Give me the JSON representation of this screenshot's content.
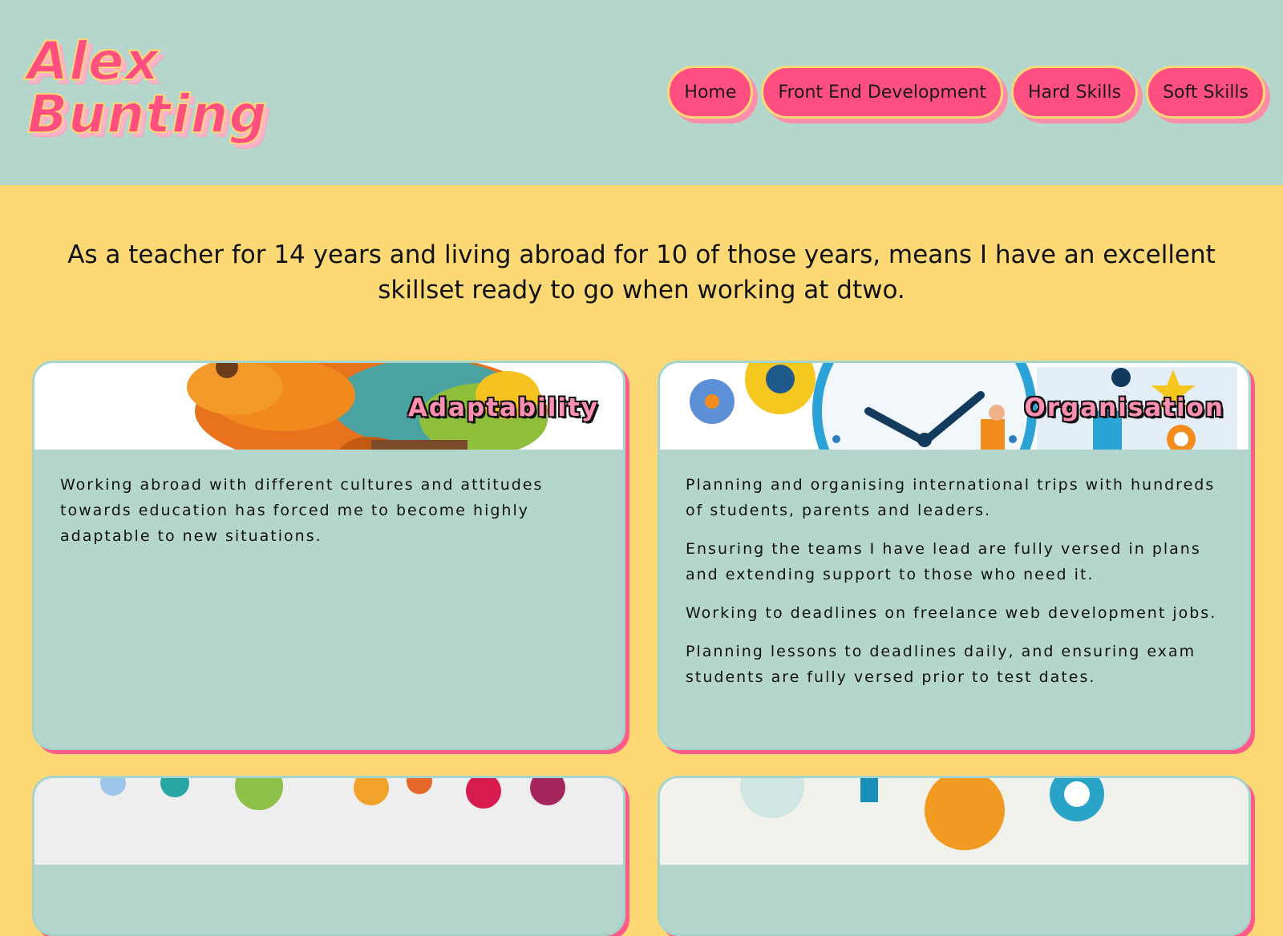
{
  "site": {
    "logo_line1": "Alex",
    "logo_line2": "Bunting"
  },
  "nav": {
    "items": [
      {
        "label": "Home"
      },
      {
        "label": "Front End Development"
      },
      {
        "label": "Hard Skills"
      },
      {
        "label": "Soft Skills"
      }
    ]
  },
  "intro": {
    "text": "As a teacher for 14 years and living abroad for 10 of those years, means I have an excellent skillset ready to go when working at dtwo."
  },
  "cards": [
    {
      "title": "Adaptability",
      "image": "chameleon-illustration",
      "paragraphs": [
        "Working abroad with different cultures and attitudes towards education has forced me to become highly adaptable to new situations."
      ]
    },
    {
      "title": "Organisation",
      "image": "clock-gears-planning-illustration",
      "paragraphs": [
        "Planning and organising international trips with hundreds of students, parents and leaders.",
        "Ensuring the teams I have lead are fully versed in plans and extending support to those who need it.",
        "Working to deadlines on freelance web development jobs.",
        "Planning lessons to deadlines daily, and ensuring exam students are fully versed prior to test dates."
      ]
    },
    {
      "image": "communication-network-illustration"
    },
    {
      "image": "teamwork-gears-illustration"
    }
  ],
  "colors": {
    "header_bg": "#b4d6cd",
    "page_bg": "#fdd976",
    "accent_pink": "#ff4f81",
    "card_bg": "#b4d6cd"
  }
}
